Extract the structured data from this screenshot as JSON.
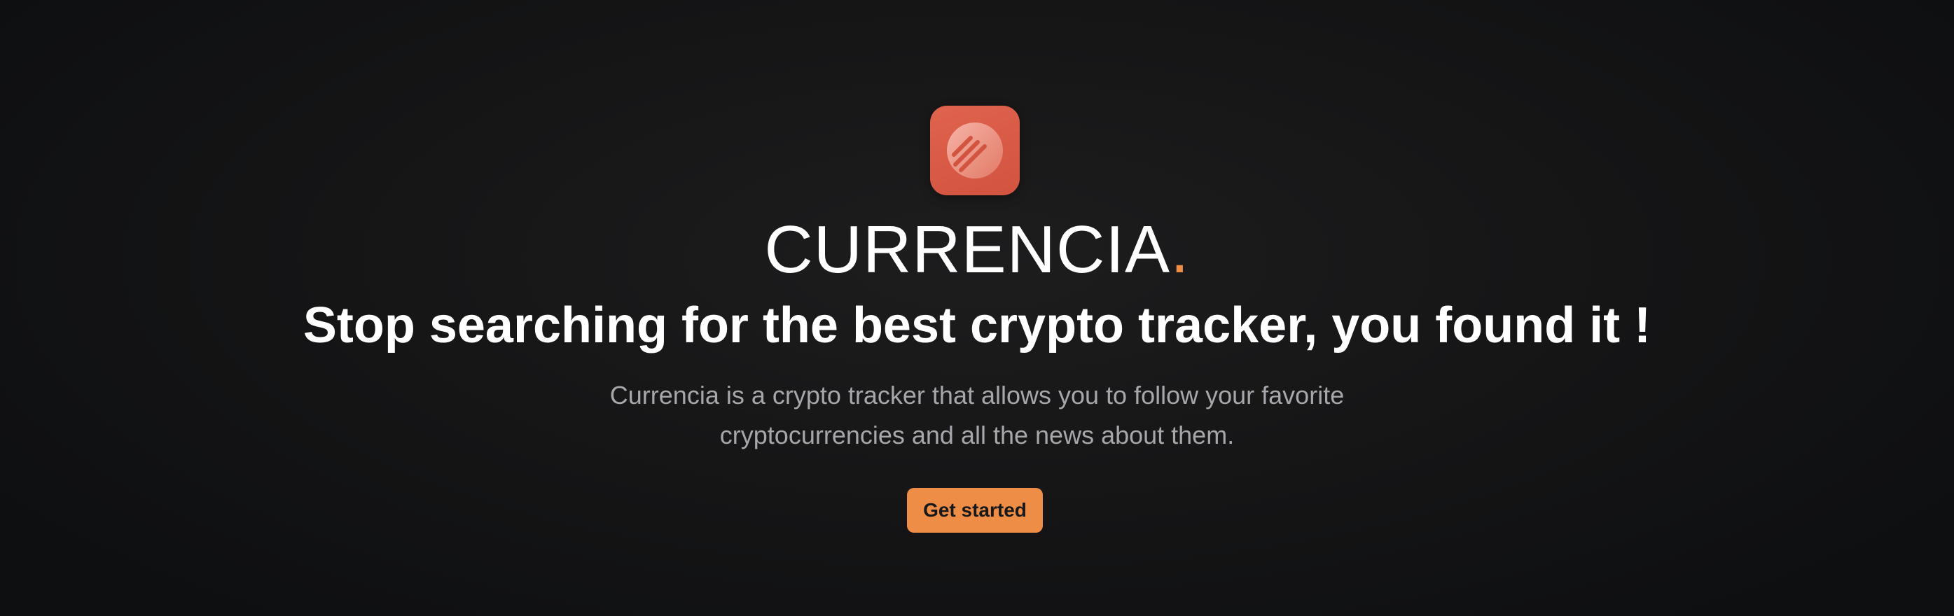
{
  "hero": {
    "logo_icon": "currencia-logo-icon",
    "brand_name": "CURRENCIA",
    "brand_dot": ".",
    "headline": "Stop searching for the best crypto tracker, you found it !",
    "description": "Currencia is a crypto tracker that allows you to follow your favorite cryptocurrencies and all the news about them.",
    "cta_label": "Get started"
  },
  "colors": {
    "background": "#151516",
    "accent": "#ee8d45",
    "logo_background": "#d9593f",
    "text_primary": "#ffffff",
    "text_secondary": "#a6a6ab"
  }
}
